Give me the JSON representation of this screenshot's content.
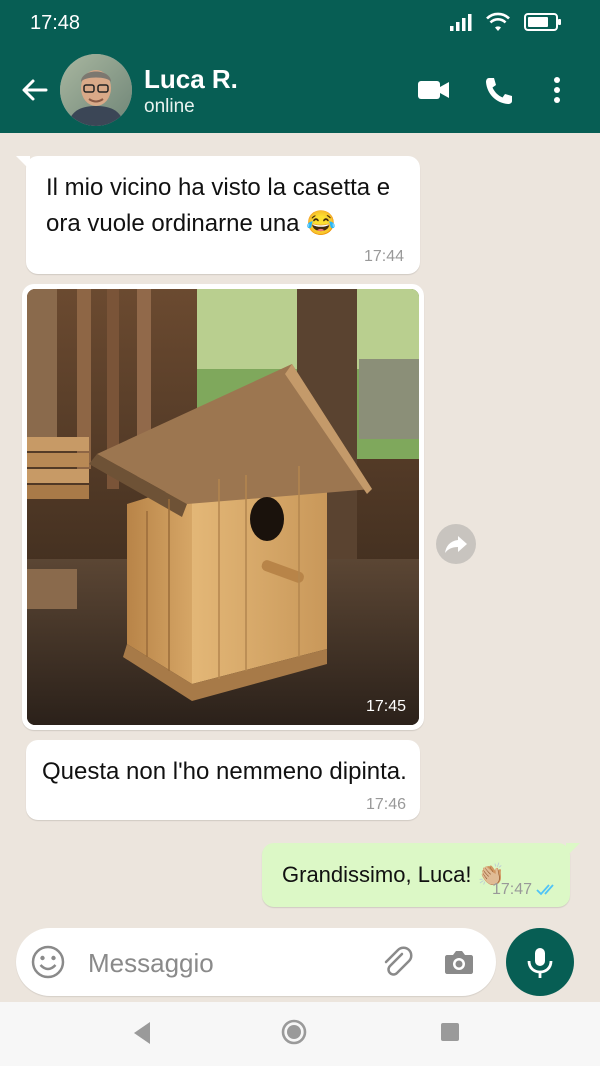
{
  "status_bar": {
    "time": "17:48"
  },
  "header": {
    "contact_name": "Luca R.",
    "contact_status": "online"
  },
  "messages": [
    {
      "direction": "incoming",
      "type": "text",
      "text_line1": "Il mio vicino ha visto la casetta e",
      "text_line2": "ora vuole ordinarne una 😂",
      "time": "17:44"
    },
    {
      "direction": "incoming",
      "type": "image",
      "image_subject": "wooden birdhouse",
      "time": "17:45"
    },
    {
      "direction": "incoming",
      "type": "text",
      "text": "Questa non l'ho nemmeno dipinta.",
      "time": "17:46"
    },
    {
      "direction": "outgoing",
      "type": "text",
      "text": "Grandissimo, Luca! 👏🏼",
      "time": "17:47",
      "read_status": "read"
    }
  ],
  "composer": {
    "placeholder": "Messaggio"
  },
  "icons": {
    "back": "arrow-left-icon",
    "video": "video-call-icon",
    "phone": "phone-icon",
    "menu": "more-vert-icon",
    "emoji": "emoji-icon",
    "attach": "paperclip-icon",
    "camera": "camera-icon",
    "mic": "microphone-icon",
    "forward": "forward-icon"
  },
  "colors": {
    "header_bg": "#075e54",
    "chat_bg": "#ece5dd",
    "outgoing_bubble": "#dcf8c6",
    "incoming_bubble": "#ffffff",
    "read_ticks": "#4fc3f7"
  }
}
